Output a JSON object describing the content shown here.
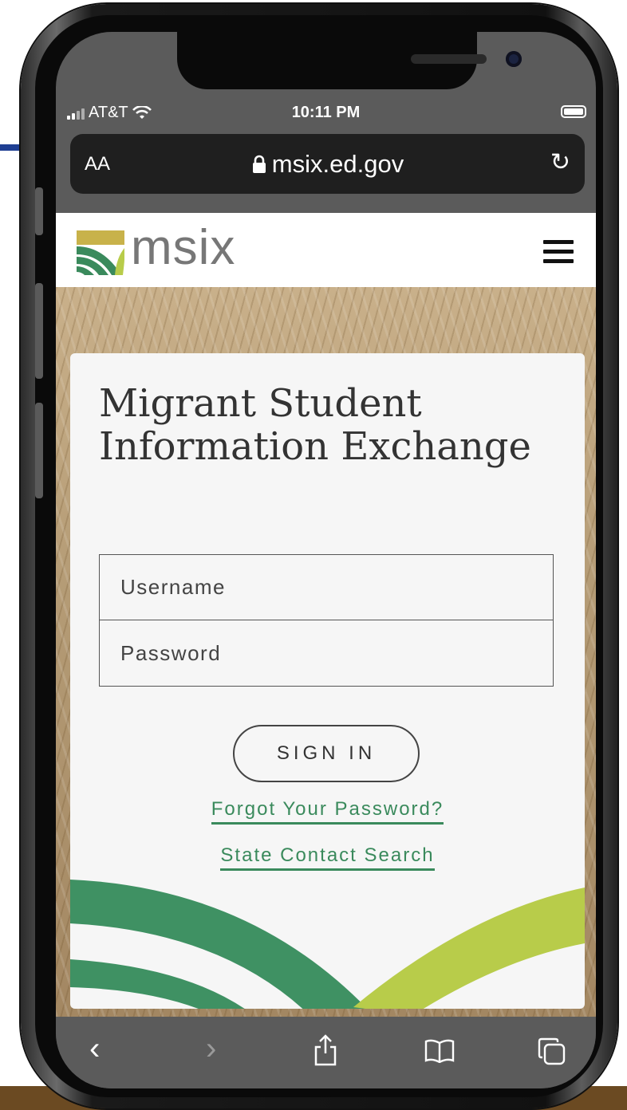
{
  "status_bar": {
    "carrier": "AT&T",
    "time": "10:11 PM"
  },
  "browser": {
    "text_size_label": "AA",
    "url": "msix.ed.gov"
  },
  "site": {
    "logo_text": "msix"
  },
  "login": {
    "title": "Migrant Student Information Exchange",
    "username_placeholder": "Username",
    "password_placeholder": "Password",
    "sign_in_label": "SIGN IN",
    "forgot_password_link": "Forgot Your Password?",
    "state_contact_link": "State Contact Search"
  },
  "colors": {
    "accent_green": "#3a8a5c",
    "light_green": "#b8cc4a",
    "logo_gold": "#c8b24a"
  }
}
